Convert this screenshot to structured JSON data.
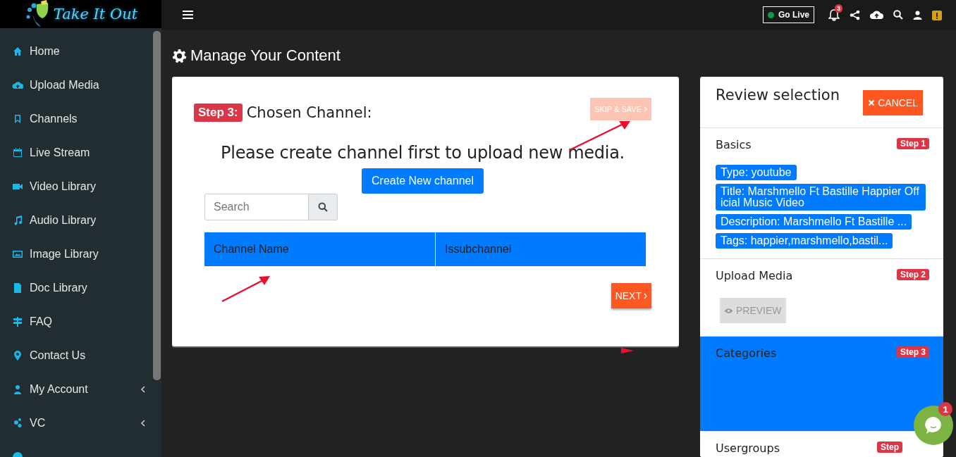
{
  "logo": {
    "text": "Take It Out"
  },
  "sidebar": {
    "items": [
      {
        "label": "Home",
        "expandable": false
      },
      {
        "label": "Upload Media",
        "expandable": false
      },
      {
        "label": "Channels",
        "expandable": false
      },
      {
        "label": "Live Stream",
        "expandable": false
      },
      {
        "label": "Video Library",
        "expandable": false
      },
      {
        "label": "Audio Library",
        "expandable": false
      },
      {
        "label": "Image Library",
        "expandable": false
      },
      {
        "label": "Doc Library",
        "expandable": false
      },
      {
        "label": "FAQ",
        "expandable": false
      },
      {
        "label": "Contact Us",
        "expandable": false
      },
      {
        "label": "My Account",
        "expandable": true
      },
      {
        "label": "VC",
        "expandable": true
      }
    ]
  },
  "topbar": {
    "go_live": "Go Live",
    "notification_count": "3"
  },
  "page_title": "Manage Your Content",
  "step_card": {
    "step_badge": "Step 3:",
    "heading": "Chosen Channel:",
    "skip_button": "SKIP & SAVE",
    "message": "Please create channel first to upload new media.",
    "create_button": "Create New channel",
    "search": {
      "placeholder": "Search"
    },
    "table": {
      "columns": [
        "Channel Name",
        "Issubchannel"
      ]
    },
    "next_button": "NEXT"
  },
  "review": {
    "title": "Review selection",
    "cancel_button": "CANCEL",
    "sections": [
      {
        "title": "Basics",
        "step": "Step 1",
        "selected": false,
        "kind": "tags",
        "tags": [
          "Type: youtube",
          "Title: Marshmello Ft Bastille Happier Official Music Video",
          "Description: Marshmello Ft Bastille ...",
          "Tags: happier,marshmello,bastil..."
        ]
      },
      {
        "title": "Upload Media",
        "step": "Step 2",
        "selected": false,
        "kind": "preview",
        "button": "PREVIEW"
      },
      {
        "title": "Categories",
        "step": "Step 3",
        "selected": true,
        "kind": "empty"
      },
      {
        "title": "Usergroups",
        "step": "Step",
        "selected": false,
        "kind": "empty"
      }
    ]
  },
  "chat": {
    "unread": "1"
  }
}
